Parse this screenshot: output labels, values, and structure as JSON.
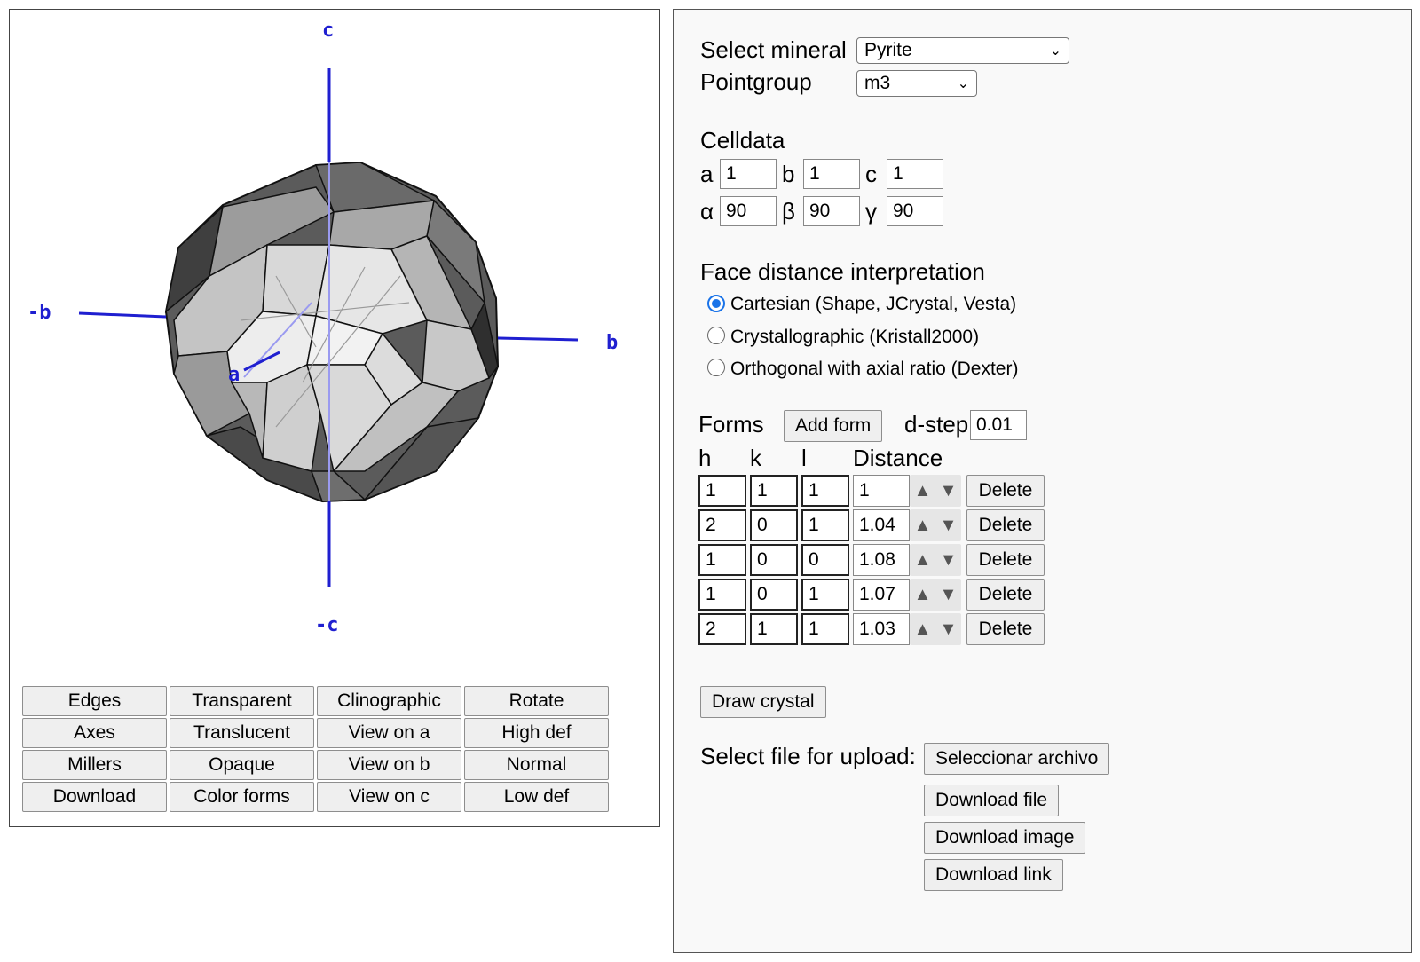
{
  "viewer": {
    "axes": {
      "c": "c",
      "neg_c": "-c",
      "b": "b",
      "neg_b": "-b",
      "a": "a"
    },
    "buttons": [
      [
        "Edges",
        "Transparent",
        "Clinographic",
        "Rotate"
      ],
      [
        "Axes",
        "Translucent",
        "View on a",
        "High def"
      ],
      [
        "Millers",
        "Opaque",
        "View on b",
        "Normal"
      ],
      [
        "Download",
        "Color forms",
        "View on c",
        "Low def"
      ]
    ],
    "colors": {
      "axis": "#1f1fd0",
      "edge": "#111111",
      "face_light": "#e8e8e8",
      "face_dark": "#4a4a4a"
    }
  },
  "controls": {
    "select_mineral_label": "Select mineral",
    "mineral_value": "Pyrite",
    "pointgroup_label": "Pointgroup",
    "pointgroup_value": "m3",
    "celldata_label": "Celldata",
    "cell": {
      "a_label": "a",
      "a": "1",
      "b_label": "b",
      "b": "1",
      "c_label": "c",
      "c": "1",
      "alpha_label": "α",
      "alpha": "90",
      "beta_label": "β",
      "beta": "90",
      "gamma_label": "γ",
      "gamma": "90"
    },
    "face_distance_label": "Face distance interpretation",
    "interpretations": [
      {
        "label": "Cartesian (Shape, JCrystal, Vesta)",
        "checked": true
      },
      {
        "label": "Crystallographic (Kristall2000)",
        "checked": false
      },
      {
        "label": "Orthogonal with axial ratio (Dexter)",
        "checked": false
      }
    ],
    "forms_label": "Forms",
    "add_form_label": "Add form",
    "dstep_label": "d-step",
    "dstep_value": "0.01",
    "col_h": "h",
    "col_k": "k",
    "col_l": "l",
    "col_distance": "Distance",
    "forms": [
      {
        "h": "1",
        "k": "1",
        "l": "1",
        "distance": "1"
      },
      {
        "h": "2",
        "k": "0",
        "l": "1",
        "distance": "1.04"
      },
      {
        "h": "1",
        "k": "0",
        "l": "0",
        "distance": "1.08"
      },
      {
        "h": "1",
        "k": "0",
        "l": "1",
        "distance": "1.07"
      },
      {
        "h": "2",
        "k": "1",
        "l": "1",
        "distance": "1.03"
      }
    ],
    "spin_up": "▲",
    "spin_down": "▼",
    "delete_label": "Delete",
    "draw_label": "Draw crystal",
    "upload_label": "Select file for upload:",
    "choose_file_label": "Seleccionar archivo",
    "download_file_label": "Download file",
    "download_image_label": "Download image",
    "download_link_label": "Download link",
    "accent_color": "#1a73e8"
  }
}
